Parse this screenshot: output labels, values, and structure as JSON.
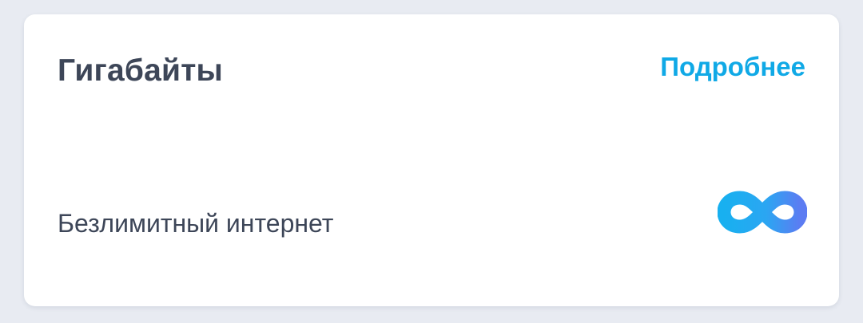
{
  "card": {
    "title": "Гигабайты",
    "details_link": "Подробнее",
    "description": "Безлимитный интернет",
    "icon": "infinity-icon"
  },
  "colors": {
    "page_background": "#e8ebf2",
    "card_background": "#ffffff",
    "text_primary": "#3d4658",
    "link": "#10a9e6",
    "icon_gradient_start": "#18b0f0",
    "icon_gradient_end": "#5c7cf2"
  }
}
